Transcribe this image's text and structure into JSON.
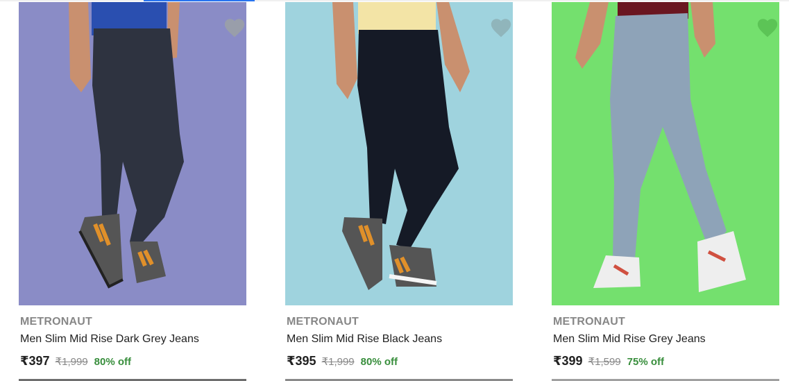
{
  "products": [
    {
      "brand": "METRONAUT",
      "title": "Men Slim Mid Rise Dark Grey Jeans",
      "price": "₹397",
      "mrp": "₹1,999",
      "discount": "80% off",
      "background": "#8a8cc6",
      "jeans_color": "#2e3340",
      "shirt_color": "#2a4fb0",
      "shoe_color": "#555555",
      "accent": "#e0902a",
      "wishlist_icon": "heart-icon"
    },
    {
      "brand": "METRONAUT",
      "title": "Men Slim Mid Rise Black Jeans",
      "price": "₹395",
      "mrp": "₹1,999",
      "discount": "80% off",
      "background": "#9fd3de",
      "jeans_color": "#151a26",
      "shirt_color": "#f3e4a6",
      "shoe_color": "#555555",
      "accent": "#e0902a",
      "wishlist_icon": "heart-icon"
    },
    {
      "brand": "METRONAUT",
      "title": "Men Slim Mid Rise Grey Jeans",
      "price": "₹399",
      "mrp": "₹1,599",
      "discount": "75% off",
      "background": "#74e06e",
      "jeans_color": "#8ea3b8",
      "shirt_color": "#6a1620",
      "shoe_color": "#eeeeee",
      "accent": "#d05040",
      "wishlist_icon": "heart-icon"
    }
  ],
  "colors": {
    "price": "#212121",
    "brand": "#878787",
    "discount": "#388e3c",
    "heart": "#9aa0a6",
    "heart_green": "#5cc456"
  }
}
